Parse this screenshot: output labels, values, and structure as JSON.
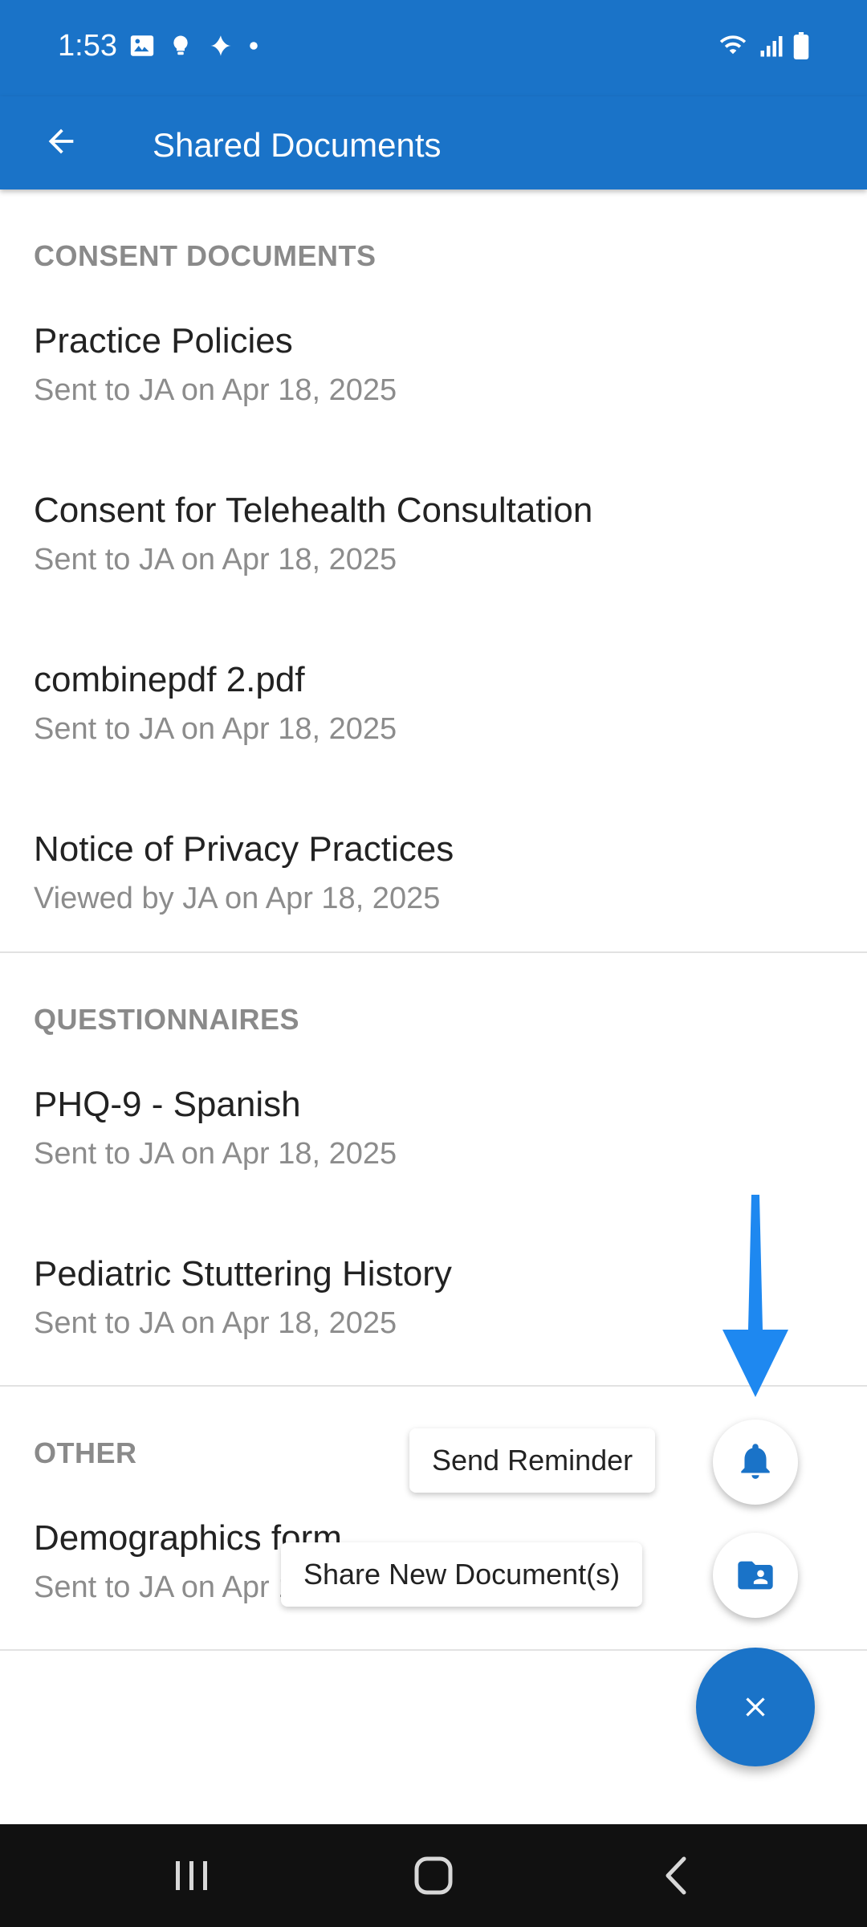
{
  "status_bar": {
    "time": "1:53"
  },
  "app_bar": {
    "title": "Shared Documents"
  },
  "sections": {
    "consent": {
      "header": "CONSENT DOCUMENTS",
      "items": [
        {
          "title": "Practice Policies",
          "sub": "Sent to JA on Apr 18, 2025"
        },
        {
          "title": "Consent for Telehealth Consultation",
          "sub": "Sent to JA on Apr 18, 2025"
        },
        {
          "title": "combinepdf 2.pdf",
          "sub": "Sent to JA on Apr 18, 2025"
        },
        {
          "title": "Notice of Privacy Practices",
          "sub": "Viewed by JA on Apr 18, 2025"
        }
      ]
    },
    "questionnaires": {
      "header": "QUESTIONNAIRES",
      "items": [
        {
          "title": "PHQ-9 - Spanish",
          "sub": "Sent to JA on Apr 18, 2025"
        },
        {
          "title": "Pediatric Stuttering History",
          "sub": "Sent to JA on Apr 18, 2025"
        }
      ]
    },
    "other": {
      "header": "OTHER",
      "items": [
        {
          "title": "Demographics form",
          "sub": "Sent to JA on Apr 18, 2025"
        }
      ]
    }
  },
  "fab_menu": {
    "send_reminder_label": "Send Reminder",
    "share_new_label": "Share New Document(s)"
  },
  "colors": {
    "primary": "#1a73c8",
    "hint_arrow": "#1e88f0"
  },
  "icons": {
    "back": "arrow-left",
    "reminder": "bell",
    "share": "folder-shared",
    "close": "close-x"
  }
}
